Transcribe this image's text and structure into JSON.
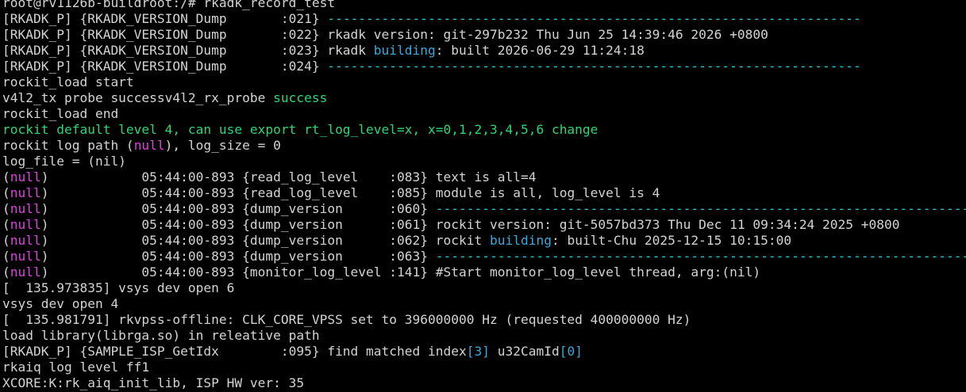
{
  "colors": {
    "background": "#000000",
    "default": "#d3d3d3",
    "cyan": "#2ec4d6",
    "green": "#2ed573",
    "magenta": "#e040e0",
    "blue": "#3aa8d8"
  },
  "lines": [
    [
      {
        "t": "root@rv1126b-buildroot:/# rkadk_record_test",
        "c": "default"
      }
    ],
    [
      {
        "t": "[RKADK_P] {RKADK_VERSION_Dump       :021} ",
        "c": "default"
      },
      {
        "t": "---------------------------------------------------------------------",
        "c": "cyan"
      }
    ],
    [
      {
        "t": "[RKADK_P] {RKADK_VERSION_Dump       :022} rkadk version: git-297b232 Thu Jun 25 14:39:46 2026 +0800",
        "c": "default"
      }
    ],
    [
      {
        "t": "[RKADK_P] {RKADK_VERSION_Dump       :023} rkadk ",
        "c": "default"
      },
      {
        "t": "building",
        "c": "blue"
      },
      {
        "t": ": built 2026-06-29 11:24:18",
        "c": "default"
      }
    ],
    [
      {
        "t": "[RKADK_P] {RKADK_VERSION_Dump       :024} ",
        "c": "default"
      },
      {
        "t": "---------------------------------------------------------------------",
        "c": "cyan"
      }
    ],
    [
      {
        "t": "rockit_load start",
        "c": "default"
      }
    ],
    [
      {
        "t": "v4l2_tx probe successv4l2_rx_probe ",
        "c": "default"
      },
      {
        "t": "success",
        "c": "green"
      }
    ],
    [
      {
        "t": "rockit_load end",
        "c": "default"
      }
    ],
    [
      {
        "t": "rockit default level 4, can use export rt_log_level=x, x=0,1,2,3,4,5,6 change",
        "c": "green"
      }
    ],
    [
      {
        "t": "rockit log path (",
        "c": "default"
      },
      {
        "t": "null",
        "c": "magenta"
      },
      {
        "t": "), log_size = 0",
        "c": "default"
      }
    ],
    [
      {
        "t": "log_file = (nil)",
        "c": "default"
      }
    ],
    [
      {
        "t": "(",
        "c": "default"
      },
      {
        "t": "null",
        "c": "magenta"
      },
      {
        "t": ")            05:44:00-893 {read_log_level    :083} text is all=4",
        "c": "default"
      }
    ],
    [
      {
        "t": "(",
        "c": "default"
      },
      {
        "t": "null",
        "c": "magenta"
      },
      {
        "t": ")            05:44:00-893 {read_log_level    :085} module is all, log_level is 4",
        "c": "default"
      }
    ],
    [
      {
        "t": "(",
        "c": "default"
      },
      {
        "t": "null",
        "c": "magenta"
      },
      {
        "t": ")            05:44:00-893 {dump_version      :060} ",
        "c": "default"
      },
      {
        "t": "---------------------------------------------------------------------",
        "c": "cyan"
      }
    ],
    [
      {
        "t": "(",
        "c": "default"
      },
      {
        "t": "null",
        "c": "magenta"
      },
      {
        "t": ")            05:44:00-893 {dump_version      :061} rockit version: git-5057bd373 Thu Dec 11 09:34:24 2025 +0800",
        "c": "default"
      }
    ],
    [
      {
        "t": "(",
        "c": "default"
      },
      {
        "t": "null",
        "c": "magenta"
      },
      {
        "t": ")            05:44:00-893 {dump_version      :062} rockit ",
        "c": "default"
      },
      {
        "t": "building",
        "c": "blue"
      },
      {
        "t": ": built-Chu 2025-12-15 10:15:00",
        "c": "default"
      }
    ],
    [
      {
        "t": "(",
        "c": "default"
      },
      {
        "t": "null",
        "c": "magenta"
      },
      {
        "t": ")            05:44:00-893 {dump_version      :063} ",
        "c": "default"
      },
      {
        "t": "---------------------------------------------------------------------",
        "c": "cyan"
      }
    ],
    [
      {
        "t": "(",
        "c": "default"
      },
      {
        "t": "null",
        "c": "magenta"
      },
      {
        "t": ")            05:44:00-893 {monitor_log_level :141} #Start monitor_log_level thread, arg:(nil)",
        "c": "default"
      }
    ],
    [
      {
        "t": "[  135.973835] vsys dev open 6",
        "c": "default"
      }
    ],
    [
      {
        "t": "vsys dev open 4",
        "c": "default"
      }
    ],
    [
      {
        "t": "[  135.981791] rkvpss-offline: CLK_CORE_VPSS set to 396000000 Hz (requested 400000000 Hz)",
        "c": "default"
      }
    ],
    [
      {
        "t": "load library(librga.so) in releative path",
        "c": "default"
      }
    ],
    [
      {
        "t": "[RKADK_P] {SAMPLE_ISP_GetIdx        :095} find matched index",
        "c": "default"
      },
      {
        "t": "[3]",
        "c": "blue"
      },
      {
        "t": " u32CamId",
        "c": "default"
      },
      {
        "t": "[0]",
        "c": "blue"
      }
    ],
    [
      {
        "t": "rkaiq log level ff1",
        "c": "default"
      }
    ],
    [
      {
        "t": "XCORE:K:rk_aiq_init_lib, ISP HW ver: 35",
        "c": "default"
      }
    ]
  ]
}
